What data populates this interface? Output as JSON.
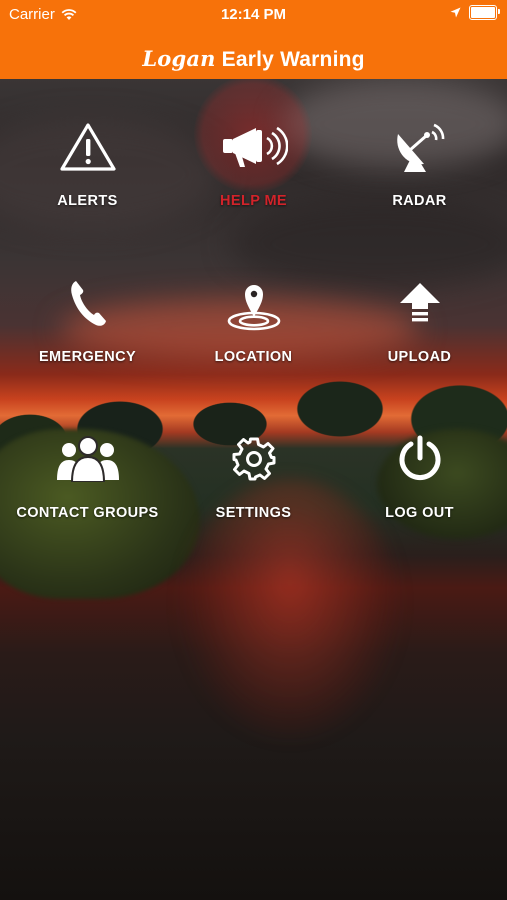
{
  "status_bar": {
    "carrier": "Carrier",
    "time": "12:14 PM",
    "icons": [
      "wifi-icon",
      "location-arrow-icon",
      "battery-icon"
    ]
  },
  "header": {
    "brand": "Logan",
    "title": "Early Warning",
    "background_color": "#f7720a"
  },
  "menu": {
    "items": [
      {
        "label": "ALERTS",
        "icon": "alert-triangle-icon"
      },
      {
        "label": "HELP ME",
        "icon": "megaphone-icon",
        "active": true
      },
      {
        "label": "RADAR",
        "icon": "satellite-dish-icon"
      },
      {
        "label": "EMERGENCY",
        "icon": "phone-icon"
      },
      {
        "label": "LOCATION",
        "icon": "map-pin-icon"
      },
      {
        "label": "UPLOAD",
        "icon": "upload-arrow-icon"
      },
      {
        "label": "CONTACT GROUPS",
        "icon": "people-group-icon"
      },
      {
        "label": "SETTINGS",
        "icon": "gear-icon"
      },
      {
        "label": "LOG OUT",
        "icon": "power-icon"
      }
    ],
    "active_color": "#d2232a"
  }
}
